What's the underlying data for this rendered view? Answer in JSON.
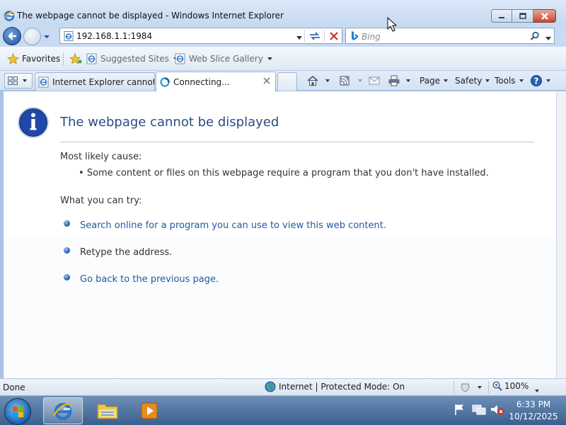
{
  "window": {
    "title": "The webpage cannot be displayed - Windows Internet Explorer"
  },
  "addressbar": {
    "url": "192.168.1.1:1984",
    "search_placeholder": "Bing"
  },
  "favorites_bar": {
    "favorites_label": "Favorites",
    "suggested_sites_label": "Suggested Sites",
    "web_slice_gallery_label": "Web Slice Gallery"
  },
  "tabs": [
    {
      "label": "Internet Explorer cannot ...",
      "active": false
    },
    {
      "label": "Connecting...",
      "active": true
    }
  ],
  "command_bar": {
    "page_label": "Page",
    "safety_label": "Safety",
    "tools_label": "Tools"
  },
  "content": {
    "heading": "The webpage cannot be displayed",
    "cause_label": "Most likely cause:",
    "cause_item": "Some content or files on this webpage require a program that you don't have installed.",
    "try_label": "What you can try:",
    "actions": [
      {
        "text": "Search online for a program you can use to view this web content.",
        "link": true
      },
      {
        "text": "Retype the address.",
        "link": false
      },
      {
        "text": "Go back to the previous page.",
        "link": true
      }
    ]
  },
  "statusbar": {
    "status_text": "Done",
    "zone_text": "Internet | Protected Mode: On",
    "zoom_text": "100%"
  },
  "taskbar": {
    "time": "6:33 PM",
    "date": "10/12/2025"
  },
  "colors": {
    "heading": "#2c4c82",
    "link": "#1f5aa6",
    "close_button": "#c8452f"
  }
}
